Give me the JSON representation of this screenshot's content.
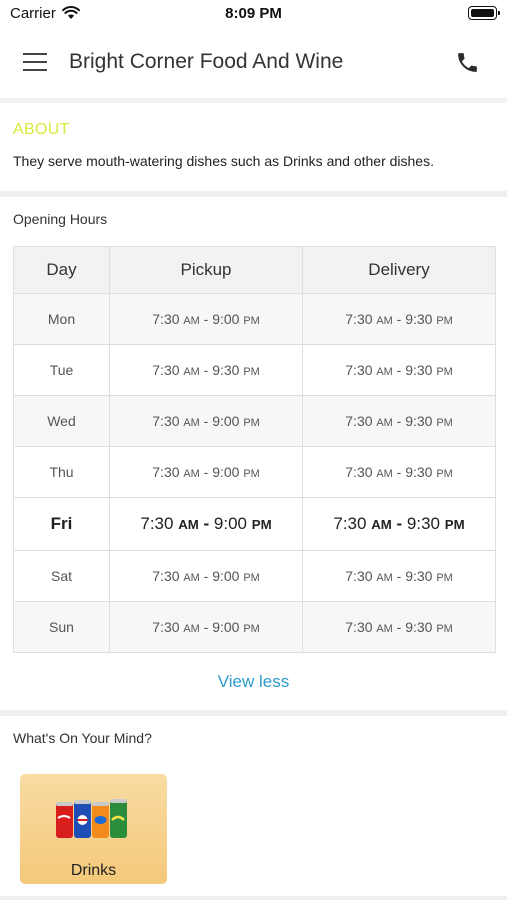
{
  "status_bar": {
    "carrier": "Carrier",
    "time": "8:09 PM"
  },
  "header": {
    "title": "Bright Corner Food And Wine",
    "menu_icon": "hamburger-menu-icon",
    "phone_icon": "phone-icon"
  },
  "about": {
    "heading": "ABOUT",
    "heading_color": "#d9ea3b",
    "text": "They serve mouth-watering dishes such as Drinks and other dishes."
  },
  "opening_hours": {
    "heading": "Opening Hours",
    "columns": [
      "Day",
      "Pickup",
      "Delivery"
    ],
    "rows": [
      {
        "day": "Mon",
        "pickup_open": "7:30",
        "pickup_open_ampm": "AM",
        "pickup_close": "9:00",
        "pickup_close_ampm": "PM",
        "delivery_open": "7:30",
        "delivery_open_ampm": "AM",
        "delivery_close": "9:30",
        "delivery_close_ampm": "PM"
      },
      {
        "day": "Tue",
        "pickup_open": "7:30",
        "pickup_open_ampm": "AM",
        "pickup_close": "9:30",
        "pickup_close_ampm": "PM",
        "delivery_open": "7:30",
        "delivery_open_ampm": "AM",
        "delivery_close": "9:30",
        "delivery_close_ampm": "PM"
      },
      {
        "day": "Wed",
        "pickup_open": "7:30",
        "pickup_open_ampm": "AM",
        "pickup_close": "9:00",
        "pickup_close_ampm": "PM",
        "delivery_open": "7:30",
        "delivery_open_ampm": "AM",
        "delivery_close": "9:30",
        "delivery_close_ampm": "PM"
      },
      {
        "day": "Thu",
        "pickup_open": "7:30",
        "pickup_open_ampm": "AM",
        "pickup_close": "9:00",
        "pickup_close_ampm": "PM",
        "delivery_open": "7:30",
        "delivery_open_ampm": "AM",
        "delivery_close": "9:30",
        "delivery_close_ampm": "PM"
      },
      {
        "day": "Fri",
        "pickup_open": "7:30",
        "pickup_open_ampm": "AM",
        "pickup_close": "9:00",
        "pickup_close_ampm": "PM",
        "delivery_open": "7:30",
        "delivery_open_ampm": "AM",
        "delivery_close": "9:30",
        "delivery_close_ampm": "PM"
      },
      {
        "day": "Sat",
        "pickup_open": "7:30",
        "pickup_open_ampm": "AM",
        "pickup_close": "9:00",
        "pickup_close_ampm": "PM",
        "delivery_open": "7:30",
        "delivery_open_ampm": "AM",
        "delivery_close": "9:30",
        "delivery_close_ampm": "PM"
      },
      {
        "day": "Sun",
        "pickup_open": "7:30",
        "pickup_open_ampm": "AM",
        "pickup_close": "9:00",
        "pickup_close_ampm": "PM",
        "delivery_open": "7:30",
        "delivery_open_ampm": "AM",
        "delivery_close": "9:30",
        "delivery_close_ampm": "PM"
      }
    ],
    "view_less_label": "View less",
    "link_color": "#2e9bcd"
  },
  "whats_on_your_mind": {
    "heading": "What's On Your Mind?",
    "categories": [
      {
        "label": "Drinks",
        "image": "soda-cans-image"
      }
    ]
  }
}
